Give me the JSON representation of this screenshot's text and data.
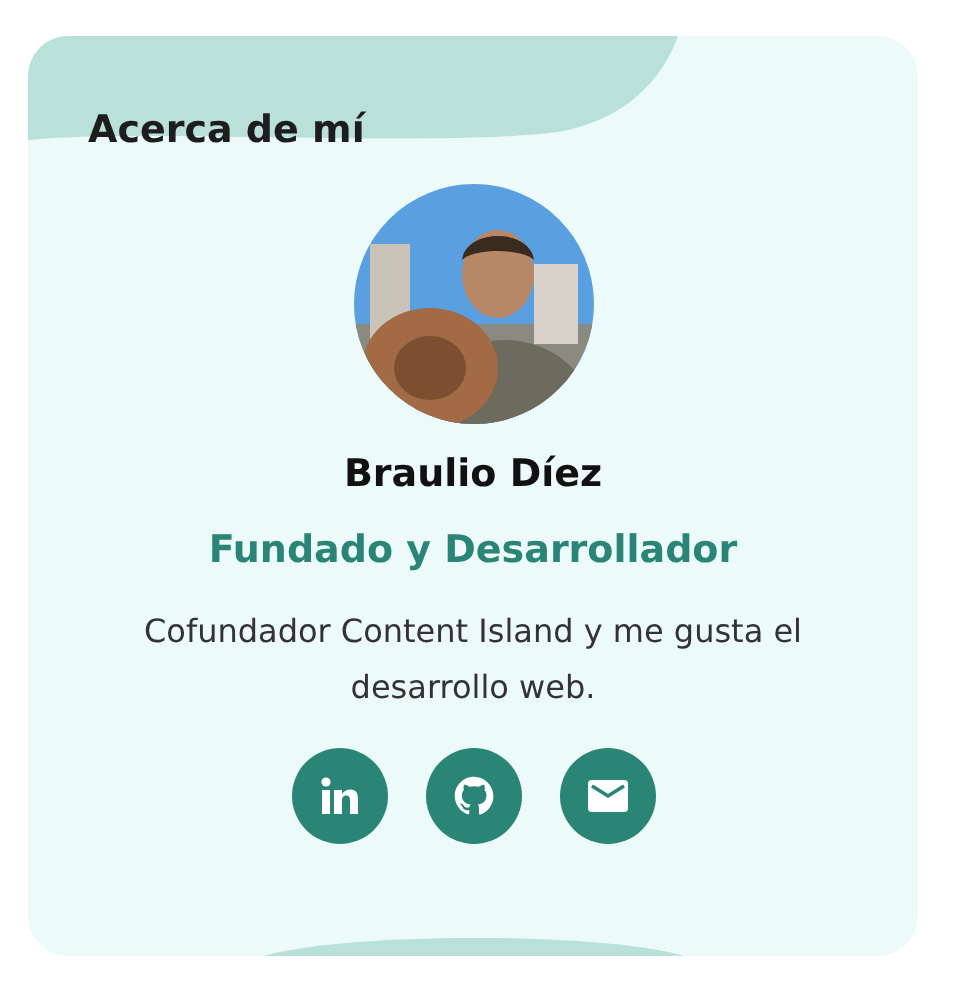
{
  "card": {
    "title": "Acerca de mí",
    "profile": {
      "name": "Braulio Díez",
      "role": "Fundado y Desarrollador",
      "description": "Cofundador Content Island y me gusta el desarrollo web."
    },
    "social": [
      {
        "kind": "linkedin"
      },
      {
        "kind": "github"
      },
      {
        "kind": "email"
      }
    ]
  }
}
